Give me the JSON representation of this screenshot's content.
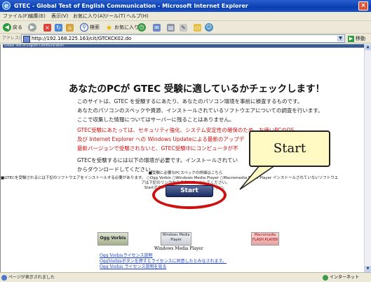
{
  "window": {
    "title": "GTEC - Global Test of English Communication - Microsoft Internet Explorer",
    "close_label": "×"
  },
  "menu": [
    "ファイル(F)",
    "編集(E)",
    "表示(V)",
    "お気に入り(A)",
    "ツール(T)",
    "ヘルプ(H)"
  ],
  "toolbar": {
    "back_label": "戻る",
    "search_label": "検索",
    "favorites_label": "お気に入り"
  },
  "address": {
    "label": "アドレス(D)",
    "url": "http://192.168.225.163/cit/GTCKCK02.do",
    "go_label": "移動"
  },
  "header_tag": "Global Test of English Communication",
  "content": {
    "heading": "あなたのPCが GTEC 受験に適しているかチェックします！",
    "para1": [
      "このサイトは、GTEC を受験するにあたり、あなたのパソコン環境を事前に検査するものです。",
      "あなたのパソコンのスペックや資源、インストールされているソフトウエアについての調査を行います。",
      "ここで収集した情報についてはサーバーに残ることはありません。"
    ],
    "para_red": [
      "GTEC受験にあたっては、セキュリティ強化、システム安定性の確保のため、お使いPCのOS",
      "及び Internet Explorer への Windows Updateによる最新のアップデ",
      "最新バージョンで受験されないと、GTEC受験中にコンピュータが不"
    ],
    "para3": [
      "GTECを受験するには以下の環境が必要です。インストールされてい",
      "からダウンロードしてください。"
    ],
    "small_info": [
      "■受験に必要なPCスペックの詳細はこちら",
      "■GTECを受験されるには下記のソフトウエアをインストールする必要があります。 ○Ogg Vorbis  ○Windows Media Player  ○Macromedia Flash Player  インストールされていないソフトウエ",
      "アは下記のリンクからダウンロードしてください。",
      "Startボタンを押して検査を開始してください。"
    ]
  },
  "callout": {
    "label": "Start"
  },
  "start_button": {
    "label": "Start"
  },
  "plugins": {
    "ogg": "Ogg Vorbis",
    "wmp_badge": "Windows Media Player",
    "flash_badge": "Macromedia FLASH PLAYER",
    "wmp_caption": "Windows Media Player"
  },
  "links": [
    "Ogg Vorbisライセンス説明",
    "OggVorbisボタンを押すとライセンスに同意したとみなされます。",
    "Ogg Vorbis ライセンス説明を見る"
  ],
  "status": {
    "text": "ページが表示されました",
    "zone": "インターネット"
  },
  "colors": {
    "titlebar": "#0a3fb0",
    "warning_text": "#cc1111",
    "highlight_ring": "#cc1111",
    "callout_bg": "#fff9c4",
    "link": "#1a3ccc"
  }
}
